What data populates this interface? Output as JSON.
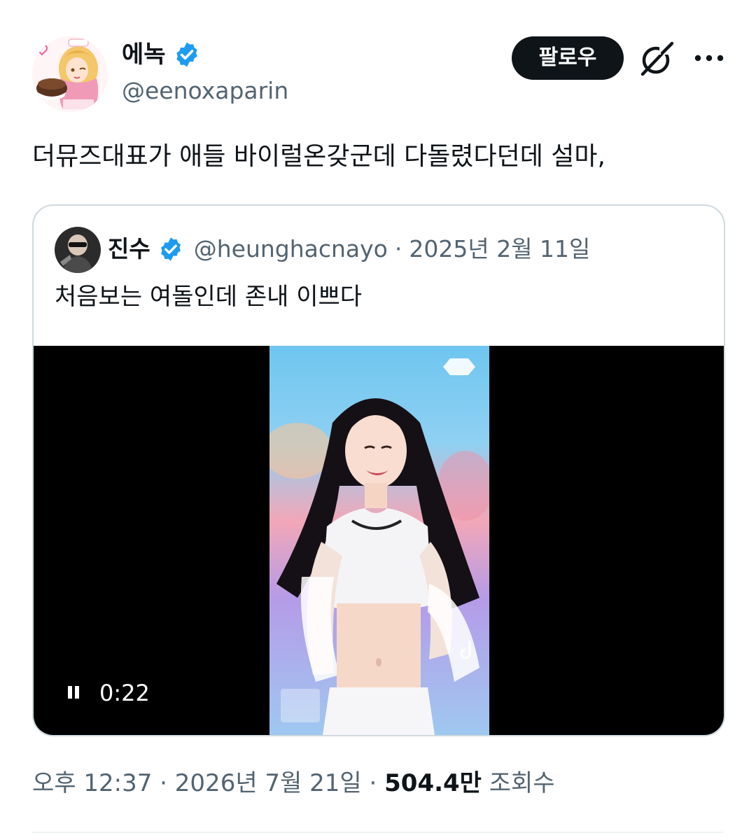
{
  "author": {
    "display_name": "에녹",
    "handle": "@eenoxaparin",
    "verified": true
  },
  "actions": {
    "follow_label": "팔로우",
    "grok_icon": "grok-icon",
    "more_icon": "more-options-icon"
  },
  "tweet": {
    "text": "더뮤즈대표가 애들 바이럴온갖군데 다돌렸다던데 설마,"
  },
  "quote": {
    "display_name": "진수",
    "handle": "@heunghacnayo",
    "separator": "·",
    "date": "2025년 2월 11일",
    "text": "처음보는 여돌인데 존내 이쁘다",
    "video": {
      "elapsed": "0:22",
      "state_icon": "pause-icon"
    }
  },
  "footer": {
    "time": "오후 12:37",
    "sep1": "·",
    "date": "2026년 7월 21일",
    "sep2": "·",
    "views_count": "504.4만",
    "views_label": "조회수"
  },
  "colors": {
    "text_primary": "#0f1419",
    "text_secondary": "#536471",
    "verified_blue": "#1d9bf0",
    "border": "#cfd9de",
    "follow_bg": "#0f1419"
  }
}
